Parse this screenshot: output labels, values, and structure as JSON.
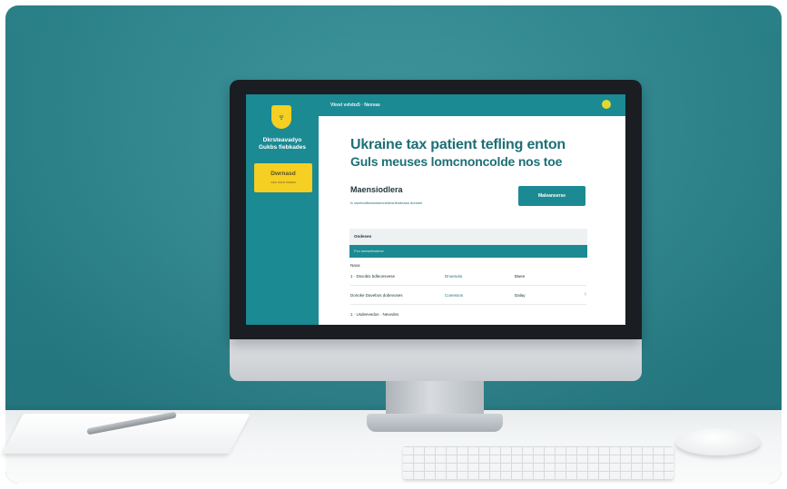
{
  "app": {
    "sidebar": {
      "logo_icon": "shield-trident-icon",
      "org_name_line1": "Dkrsteavadyo",
      "org_name_line2": "Gukbs fiebkades",
      "action_button_label": "Dwrnasd",
      "action_button_sublabel": "ssa nscs twasa"
    },
    "topbar": {
      "breadcrumb": "Vkvsl vvlvbx5 · Nexvas",
      "status_indicator": "notification-dot-icon"
    },
    "main": {
      "headline_line1": "Ukraine tax patient tefling enton",
      "headline_line2": "Guls meuses lomcnoncolde nos toe",
      "section_title": "Maensiodlera",
      "section_description": "lv vsnelodlsonswseonednsrlendeaso donsee",
      "cta_button_label": "Maleanserse",
      "panel_header": "Ondesen",
      "panel_bar_text": "Fvo oneselendeve",
      "list_label": "Nava",
      "rows": [
        {
          "col1": "1 · Dsvobis bdleonsvese",
          "col2": "Dnoesola",
          "col3": "Bwee"
        },
        {
          "col1": "Donoke Davebos dobevoses",
          "col2": "Conessos",
          "col3": "Dalay"
        },
        {
          "col1": "1 · Usdeevedos · Nevedes",
          "col2": "",
          "col3": ""
        }
      ]
    }
  },
  "scene": {
    "wall_color": "#2a8790",
    "accent_teal": "#1b8a93",
    "accent_yellow": "#f5cf21"
  }
}
